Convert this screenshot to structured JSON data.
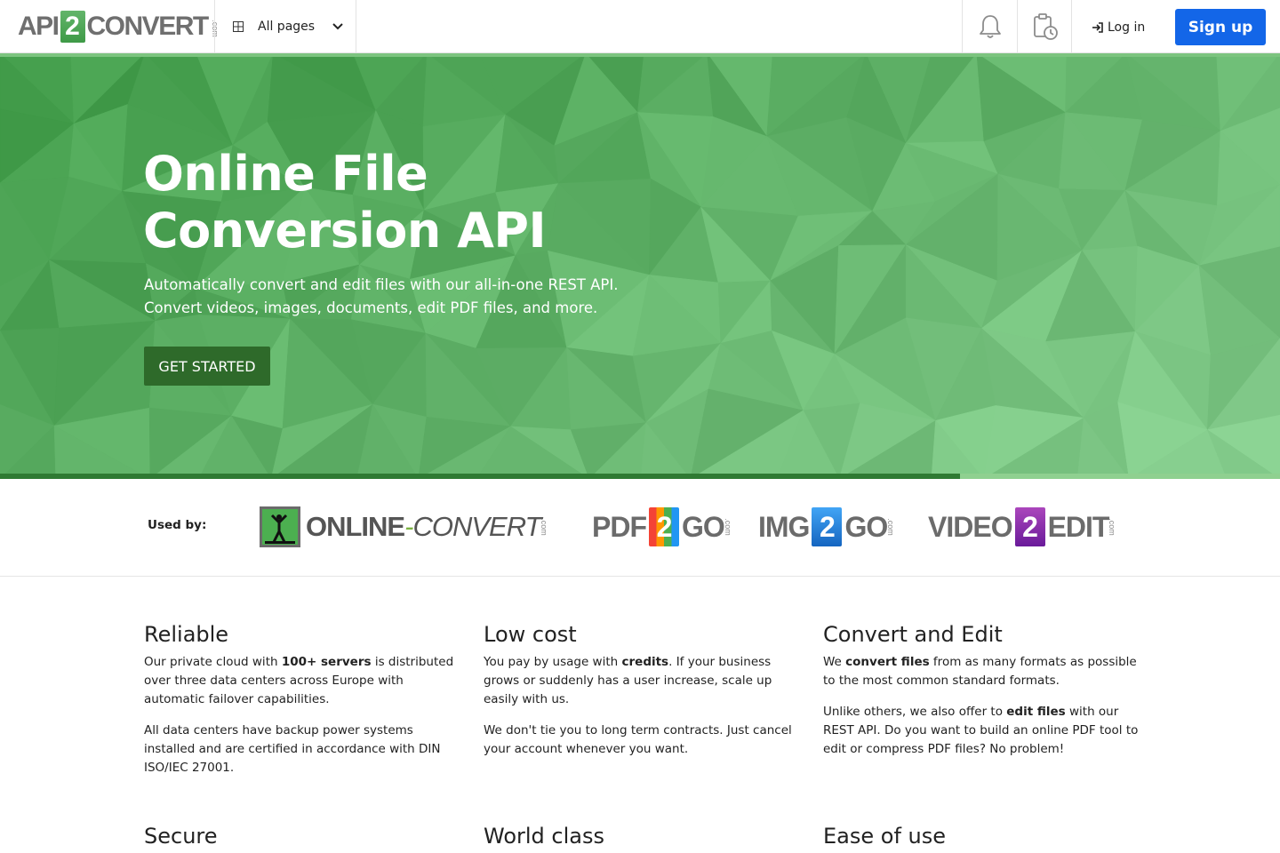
{
  "header": {
    "logo": {
      "left": "API",
      "middle": "2",
      "right": "CONVERT",
      "suffix": ".com"
    },
    "all_pages_label": "All pages",
    "login_label": "Log in",
    "signup_label": "Sign up",
    "icons": [
      "grid-icon",
      "chevron-down-icon",
      "bell-icon",
      "clipboard-history-icon",
      "login-icon"
    ]
  },
  "hero": {
    "title_line1": "Online File",
    "title_line2": "Conversion API",
    "subtitle_line1": "Automatically convert and edit files with our all-in-one REST API.",
    "subtitle_line2": "Convert videos, images, documents, edit PDF files, and more.",
    "cta_label": "GET STARTED"
  },
  "used_by": {
    "label": "Used by:",
    "partners": [
      {
        "name": "ONLINE-CONVERT",
        "first": "ONLINE",
        "dash": "-",
        "second": "CONVERT",
        "suffix": ".com"
      },
      {
        "name": "PDF2GO",
        "first": "PDF",
        "badge": "2",
        "second": "GO",
        "suffix": ".com"
      },
      {
        "name": "IMG2GO",
        "first": "IMG",
        "badge": "2",
        "second": "GO",
        "suffix": ".com"
      },
      {
        "name": "VIDEO2EDIT",
        "first": "VIDEO",
        "badge": "2",
        "second": "EDIT",
        "suffix": ".com"
      }
    ]
  },
  "features": {
    "reliable": {
      "title": "Reliable",
      "p1_a": "Our private cloud with ",
      "p1_b": "100+ servers",
      "p1_c": " is distributed over three data centers across Europe with automatic failover capabilities.",
      "p2": "All data centers have backup power systems installed and are certified in accordance with DIN ISO/IEC 27001."
    },
    "low_cost": {
      "title": "Low cost",
      "p1_a": "You pay by usage with ",
      "p1_b": "credits",
      "p1_c": ". If your business grows or suddenly has a user increase, scale up easily with us.",
      "p2": "We don't tie you to long term contracts. Just cancel your account whenever you want."
    },
    "convert_edit": {
      "title": "Convert and Edit",
      "p1_a": "We ",
      "p1_b": "convert files",
      "p1_c": " from as many formats as possible to the most common standard formats.",
      "p2_a": "Unlike others, we also offer to ",
      "p2_b": "edit files",
      "p2_c": " with our REST API. Do you want to build an online PDF tool to edit or compress PDF files? No problem!"
    },
    "secure": {
      "title": "Secure"
    },
    "world_class": {
      "title": "World class"
    },
    "ease_of_use": {
      "title": "Ease of use"
    }
  },
  "colors": {
    "brand_green": "#4caf50",
    "signup_blue": "#1366e8",
    "cta_dark_green": "#2e6a2a",
    "text": "#222222"
  }
}
